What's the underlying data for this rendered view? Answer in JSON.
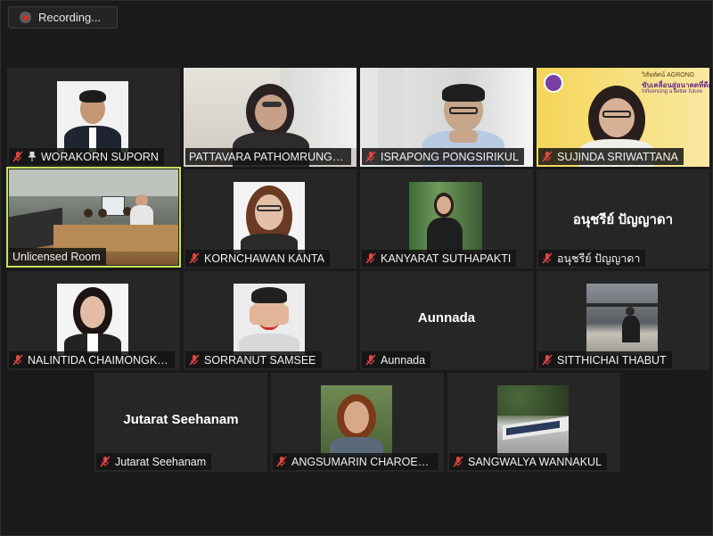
{
  "recording": {
    "label": "Recording..."
  },
  "participants": [
    {
      "name": "WORAKORN SUPORN",
      "muted": true,
      "pinned": true
    },
    {
      "name": "PATTAVARA PATHOMRUNGSIY...",
      "muted": false
    },
    {
      "name": "ISRAPONG PONGSIRIKUL",
      "muted": true
    },
    {
      "name": "SUJINDA SRIWATTANA",
      "muted": true
    },
    {
      "name": "Unlicensed Room",
      "muted": false,
      "active_speaker": true
    },
    {
      "name": "KORNCHAWAN KANTA",
      "muted": true
    },
    {
      "name": "KANYARAT SUTHAPAKTI",
      "muted": true
    },
    {
      "name": "อนุชรีย์ ปัญญาดา",
      "muted": true,
      "center_label": "อนุชรีย์ ปัญญาดา"
    },
    {
      "name": "NALINTIDA CHAIMONGKOL",
      "muted": true
    },
    {
      "name": "SORRANUT SAMSEE",
      "muted": true
    },
    {
      "name": "Aunnada",
      "muted": true,
      "center_label": "Aunnada"
    },
    {
      "name": "SITTHICHAI THABUT",
      "muted": true
    },
    {
      "name": "Jutarat Seehanam",
      "muted": true,
      "center_label": "Jutarat Seehanam"
    },
    {
      "name": "ANGSUMARIN CHAROENK...",
      "muted": true
    },
    {
      "name": "SANGWALYA WANNAKUL",
      "muted": true
    }
  ],
  "sujinda_banner": {
    "line1": "วิสัยทัศน์ AGRONG",
    "line2": "ขับเคลื่อนสู่อนาคตที่ดีกว่า",
    "line3": "Influencing a better future"
  },
  "colors": {
    "active_border": "#c7e25a",
    "muted_icon": "#e24444",
    "tile_bg": "#262626"
  }
}
